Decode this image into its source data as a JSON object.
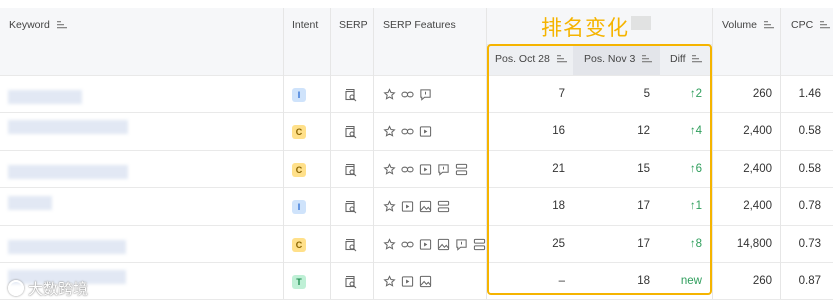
{
  "title_overlay": "排名变化",
  "watermark": "大数跨境",
  "headers": {
    "keyword": "Keyword",
    "intent": "Intent",
    "serp": "SERP",
    "serp_features": "SERP Features",
    "pos_oct": "Pos. Oct 28",
    "pos_nov": "Pos. Nov 3",
    "diff": "Diff",
    "volume": "Volume",
    "cpc": "CPC"
  },
  "rows": [
    {
      "intent": "I",
      "features": [
        "star-icon",
        "link-icon",
        "review-icon"
      ],
      "pos_oct": "7",
      "pos_nov": "5",
      "diff": "↑2",
      "volume": "260",
      "cpc": "1.46"
    },
    {
      "intent": "C",
      "features": [
        "star-icon",
        "link-icon",
        "video-icon"
      ],
      "pos_oct": "16",
      "pos_nov": "12",
      "diff": "↑4",
      "volume": "2,400",
      "cpc": "0.58"
    },
    {
      "intent": "C",
      "features": [
        "star-icon",
        "link-icon",
        "video-icon",
        "review-icon",
        "sitelinks-icon"
      ],
      "pos_oct": "21",
      "pos_nov": "15",
      "diff": "↑6",
      "volume": "2,400",
      "cpc": "0.58"
    },
    {
      "intent": "I",
      "features": [
        "star-icon",
        "video-icon",
        "image-icon",
        "sitelinks-icon"
      ],
      "pos_oct": "18",
      "pos_nov": "17",
      "diff": "↑1",
      "volume": "2,400",
      "cpc": "0.78"
    },
    {
      "intent": "C",
      "features": [
        "star-icon",
        "link-icon",
        "video-icon",
        "image-icon",
        "review-icon",
        "sitelinks-icon"
      ],
      "pos_oct": "25",
      "pos_nov": "17",
      "diff": "↑8",
      "volume": "14,800",
      "cpc": "0.73"
    },
    {
      "intent": "T",
      "features": [
        "star-icon",
        "video-icon",
        "image-icon"
      ],
      "pos_oct": "–",
      "pos_nov": "18",
      "diff": "new",
      "volume": "260",
      "cpc": "0.87"
    }
  ]
}
